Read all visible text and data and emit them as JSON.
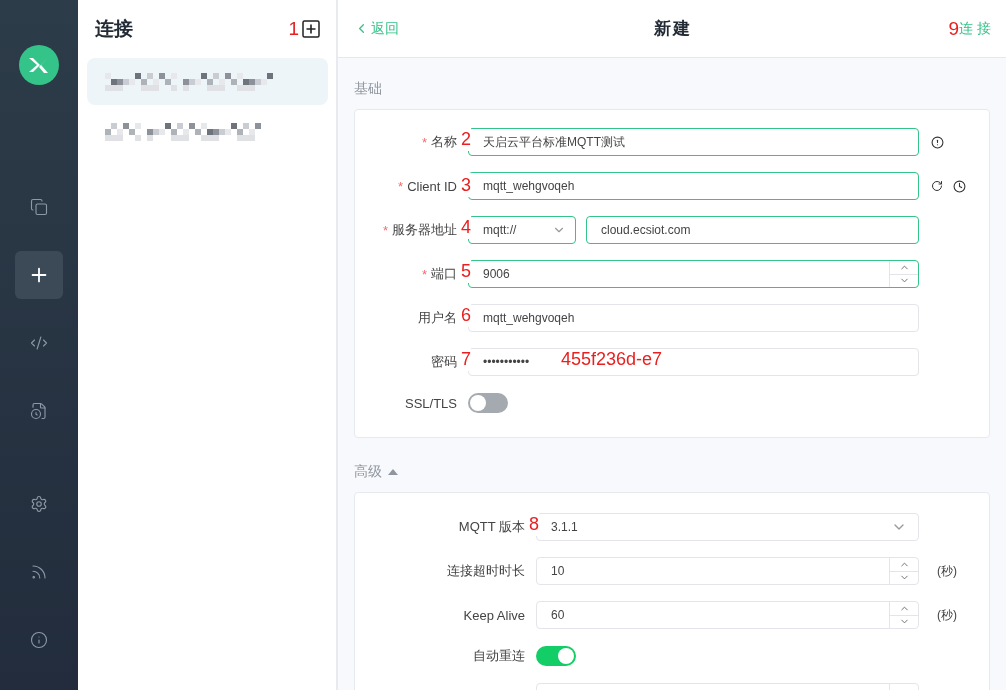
{
  "sidebar": {
    "top_items": [
      {
        "kind": "connections",
        "selected": false
      },
      {
        "kind": "new",
        "selected": true
      },
      {
        "kind": "script",
        "selected": false
      },
      {
        "kind": "log",
        "selected": false
      }
    ],
    "bottom_items": [
      {
        "kind": "settings",
        "selected": false
      },
      {
        "kind": "feed",
        "selected": false
      },
      {
        "kind": "about",
        "selected": false
      }
    ]
  },
  "connections_panel": {
    "title": "连接",
    "marker": "1",
    "items": [
      {
        "selected": true
      },
      {
        "selected": false
      }
    ]
  },
  "header": {
    "back": "返回",
    "title": "新建",
    "marker": "9",
    "action": "连 接"
  },
  "basic": {
    "title": "基础",
    "rows": [
      {
        "kind": "name",
        "label": "名称",
        "required": "*",
        "marker": "2",
        "value": "天启云平台标准MQTT测试",
        "highlighted": true
      },
      {
        "kind": "client",
        "label": "Client ID",
        "required": "*",
        "marker": "3",
        "value": "mqtt_wehgvoqeh",
        "highlighted": true
      },
      {
        "kind": "server",
        "label": "服务器地址",
        "required": "*",
        "marker": "4",
        "protocol": "mqtt://",
        "value": "cloud.ecsiot.com",
        "highlighted": true
      },
      {
        "kind": "number",
        "label": "端口",
        "required": "*",
        "marker": "5",
        "value": "9006",
        "highlighted": true
      },
      {
        "kind": "text",
        "label": "用户名",
        "marker": "6",
        "value": "mqtt_wehgvoqeh",
        "highlighted": false
      },
      {
        "kind": "password",
        "label": "密码",
        "marker": "7",
        "value": "•••••••••••",
        "note": "455f236d-e7",
        "highlighted": false
      },
      {
        "kind": "switch",
        "label": "SSL/TLS",
        "on": false
      }
    ]
  },
  "advanced": {
    "title": "高级",
    "expanded": true,
    "rows": [
      {
        "kind": "select",
        "label": "MQTT 版本",
        "marker": "8",
        "value": "3.1.1",
        "highlighted": false
      },
      {
        "kind": "number",
        "label": "连接超时时长",
        "value": "10",
        "unit": "(秒)",
        "highlighted": false
      },
      {
        "kind": "number",
        "label": "Keep Alive",
        "value": "60",
        "unit": "(秒)",
        "highlighted": false
      },
      {
        "kind": "switch",
        "label": "自动重连",
        "on": true
      },
      {
        "kind": "number",
        "highlighted": false
      }
    ]
  }
}
